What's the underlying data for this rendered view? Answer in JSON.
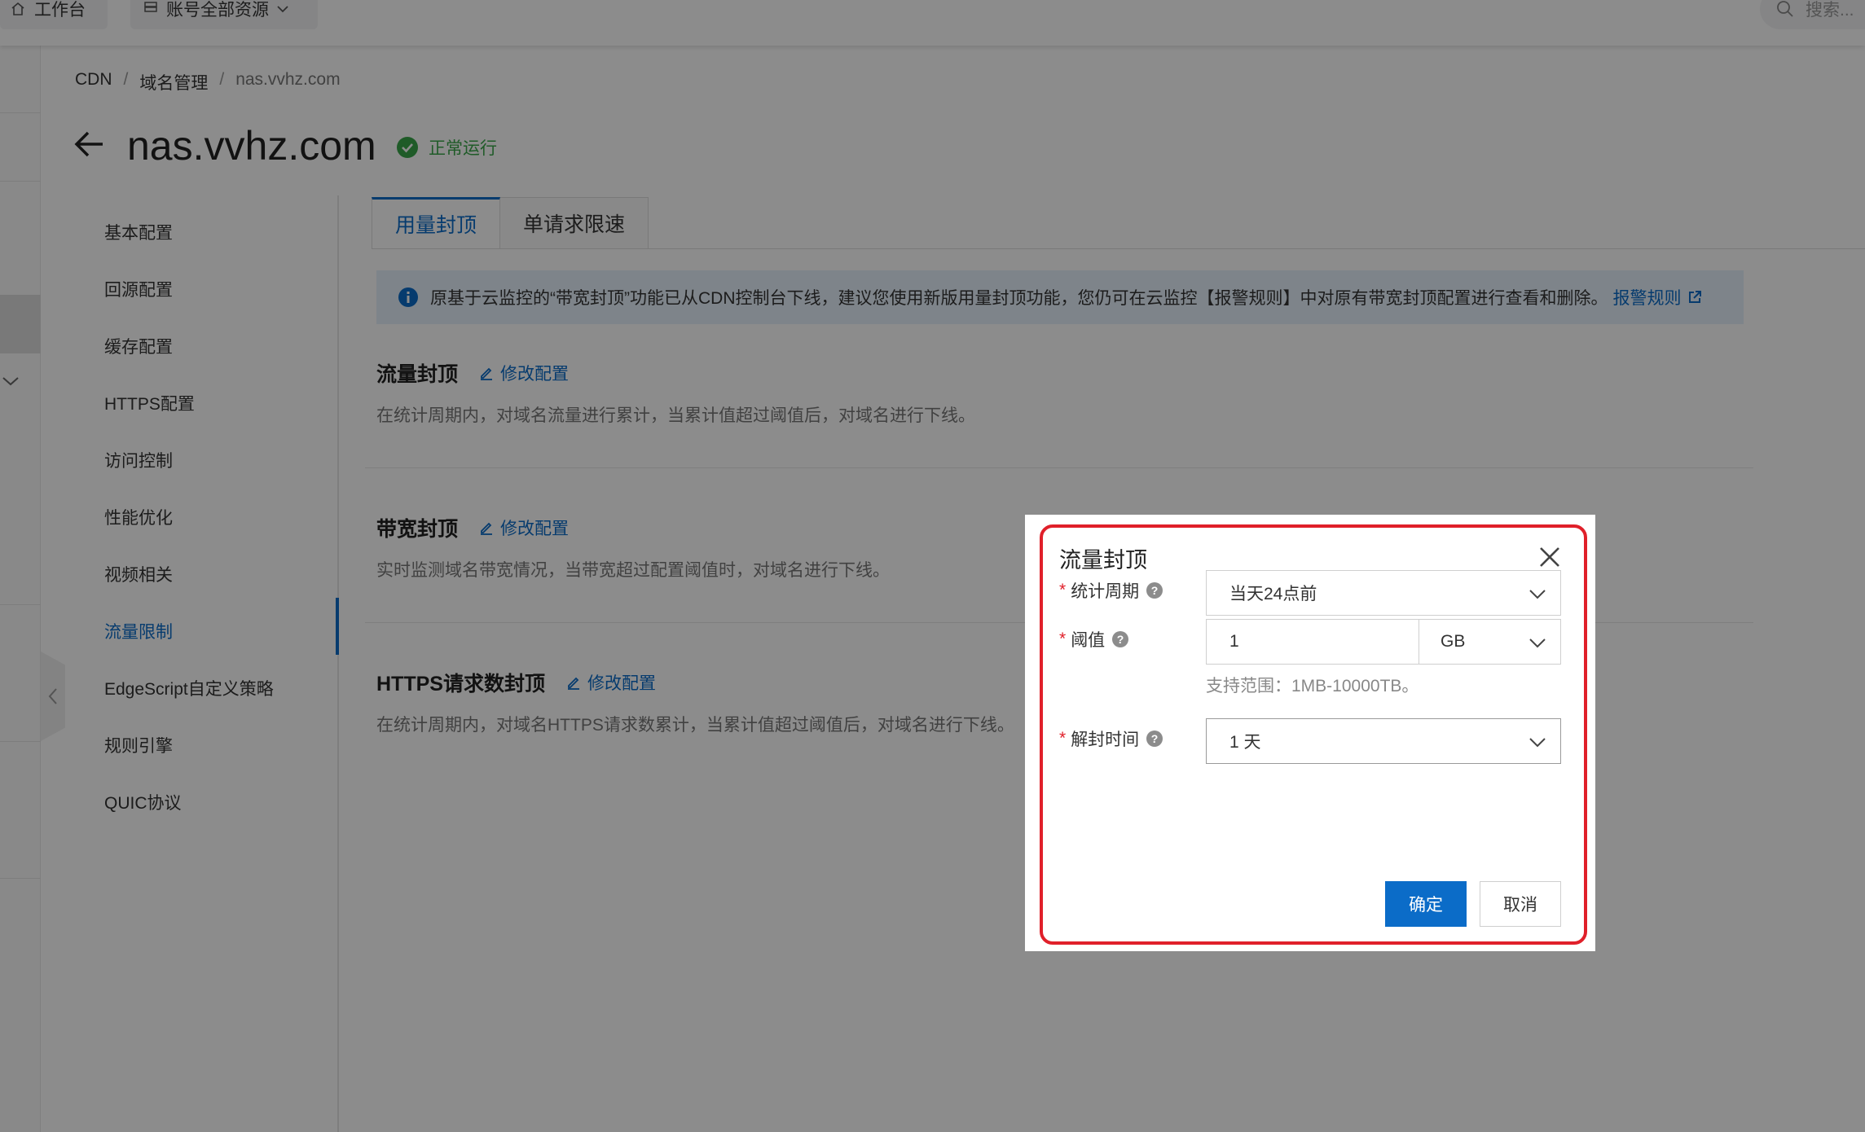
{
  "topbar": {
    "workbench_label": "工作台",
    "resources_label": "账号全部资源",
    "search_placeholder": "搜索..."
  },
  "breadcrumb": {
    "items": [
      "CDN",
      "域名管理",
      "nas.vvhz.com"
    ],
    "separator": "/"
  },
  "header": {
    "title": "nas.vvhz.com",
    "status": "正常运行",
    "status_color": "#3aa64a"
  },
  "sidemenu": {
    "items": [
      {
        "label": "基本配置"
      },
      {
        "label": "回源配置"
      },
      {
        "label": "缓存配置"
      },
      {
        "label": "HTTPS配置"
      },
      {
        "label": "访问控制"
      },
      {
        "label": "性能优化"
      },
      {
        "label": "视频相关"
      },
      {
        "label": "流量限制",
        "active": true
      },
      {
        "label": "EdgeScript自定义策略"
      },
      {
        "label": "规则引擎"
      },
      {
        "label": "QUIC协议"
      }
    ]
  },
  "tabs": [
    {
      "label": "用量封顶",
      "active": true
    },
    {
      "label": "单请求限速"
    }
  ],
  "notice": {
    "text": "原基于云监控的“带宽封顶”功能已从CDN控制台下线，建议您使用新版用量封顶功能，您仍可在云监控【报警规则】中对原有带宽封顶配置进行查看和删除。",
    "link_label": "报警规则"
  },
  "sections": [
    {
      "title": "流量封顶",
      "edit_label": "修改配置",
      "desc": "在统计周期内，对域名流量进行累计，当累计值超过阈值后，对域名进行下线。"
    },
    {
      "title": "带宽封顶",
      "edit_label": "修改配置",
      "desc": "实时监测域名带宽情况，当带宽超过配置阈值时，对域名进行下线。"
    },
    {
      "title": "HTTPS请求数封顶",
      "edit_label": "修改配置",
      "desc": "在统计周期内，对域名HTTPS请求数累计，当累计值超过阈值后，对域名进行下线。"
    }
  ],
  "modal": {
    "title": "流量封顶",
    "fields": {
      "period": {
        "label": "统计周期",
        "value": "当天24点前"
      },
      "threshold": {
        "label": "阈值",
        "value": "1",
        "unit": "GB",
        "hint": "支持范围：1MB-10000TB。"
      },
      "unblock": {
        "label": "解封时间",
        "value": "1 天"
      }
    },
    "required_mark": "*",
    "confirm_label": "确定",
    "cancel_label": "取消"
  },
  "colors": {
    "accent": "#0b6cc8",
    "highlight": "#e0202a",
    "notice_bg": "#e6f1fb"
  }
}
